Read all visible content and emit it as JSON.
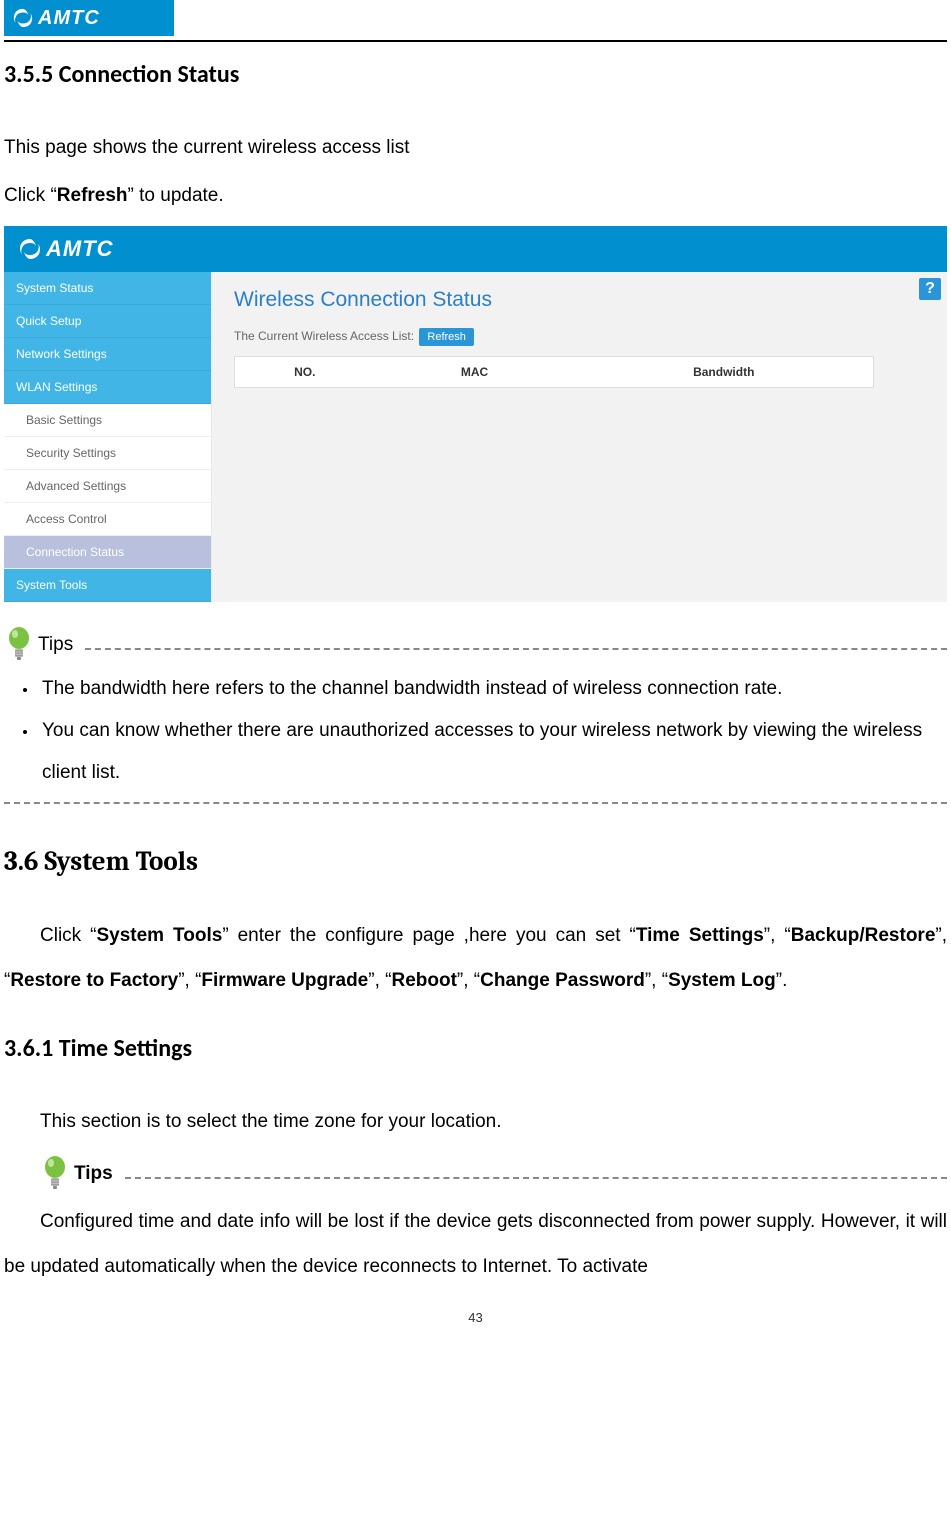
{
  "brand": "AMTC",
  "section_355_title": "3.5.5 Connection Status",
  "intro_line1": "This page shows the current wireless access list",
  "intro_line2_pre": "Click “",
  "intro_line2_bold": "Refresh",
  "intro_line2_post": "” to update.",
  "screenshot": {
    "nav": {
      "system_status": "System Status",
      "quick_setup": "Quick Setup",
      "network_settings": "Network Settings",
      "wlan_settings": "WLAN Settings",
      "basic_settings": "Basic Settings",
      "security_settings": "Security Settings",
      "advanced_settings": "Advanced Settings",
      "access_control": "Access Control",
      "connection_status": "Connection Status",
      "system_tools": "System Tools"
    },
    "panel": {
      "title": "Wireless Connection Status",
      "sub_label": "The Current Wireless Access List:",
      "refresh": "Refresh",
      "cols": {
        "no": "NO.",
        "mac": "MAC",
        "bandwidth": "Bandwidth"
      }
    },
    "help": "?"
  },
  "tips_label": "Tips",
  "tips": {
    "item1": "The bandwidth here refers to the channel bandwidth instead of wireless connection rate.",
    "item2": "You can know whether there are unauthorized accesses to your wireless network by viewing the wireless client list."
  },
  "section_36_title": "3.6 System Tools",
  "sys_tools_para": {
    "p1": "Click “",
    "b1": "System Tools",
    "p2": "” enter the configure page ,here you can set “",
    "b2": "Time Settings",
    "p3": "”, “",
    "b3": "Backup/Restore",
    "p4": "”, “",
    "b4": "Restore to Factory",
    "p5": "”, “",
    "b5": "Firmware Upgrade",
    "p6": "”, “",
    "b6": "Reboot",
    "p7": "”, “",
    "b7": "Change Password",
    "p8": "”, “",
    "b8": "System Log",
    "p9": "”."
  },
  "section_361_title": "3.6.1 Time Settings",
  "time_intro": "This section is to select the time zone for your location.",
  "tips_label2": "Tips",
  "time_tip": "Configured time and date info will be lost if the device gets disconnected from power supply. However, it will be updated automatically when the device reconnects to Internet. To activate",
  "page_number": "43"
}
